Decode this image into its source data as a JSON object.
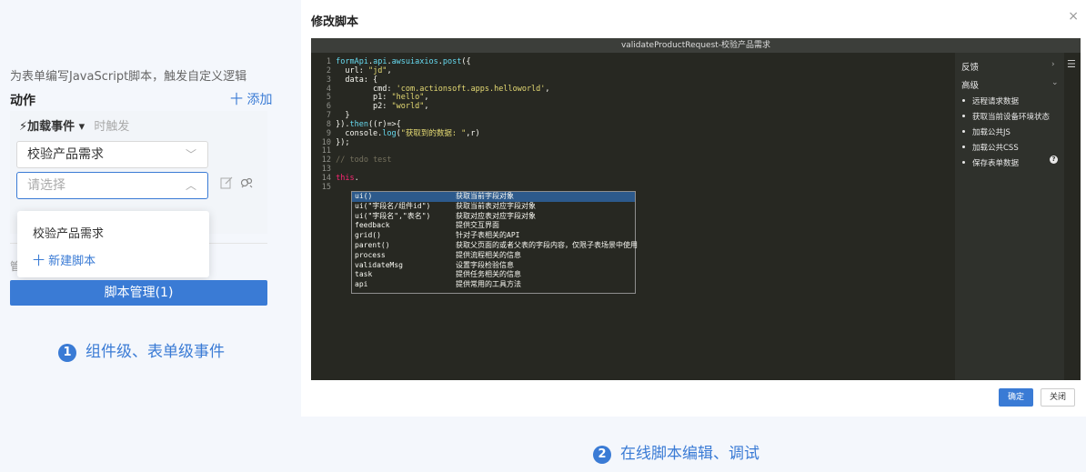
{
  "left": {
    "description": "为表单编写JavaScript脚本，触发自定义逻辑",
    "actions_title": "动作",
    "add_label": "十 添加",
    "event_label": "⚡加载事件 ▾",
    "trigger_label": "时触发",
    "select1_value": "校验产品需求",
    "select2_placeholder": "请选择",
    "dropdown": [
      "校验产品需求",
      "十 新建脚本"
    ],
    "hidden_label": "管",
    "manage_button": "脚本管理(1)",
    "caption_num": "1",
    "caption_text": "组件级、表单级事件"
  },
  "dialog": {
    "title": "修改脚本",
    "editor_title": "validateProductRequest-校验产品需求",
    "line_numbers": [
      "1",
      "2",
      "3",
      "4",
      "5",
      "6",
      "7",
      "8",
      "9",
      "10",
      "11",
      "12",
      "13",
      "14",
      "15"
    ],
    "autocomplete": [
      {
        "name": "ui()",
        "desc": "获取当前字段对象"
      },
      {
        "name": "ui(\"字段名/组件id\")",
        "desc": "获取当前表对应字段对象"
      },
      {
        "name": "ui(\"字段名\",\"表名\")",
        "desc": "获取对应表对应字段对象"
      },
      {
        "name": "feedback",
        "desc": "提供交互界面"
      },
      {
        "name": "grid()",
        "desc": "针对子表相关的API"
      },
      {
        "name": "parent()",
        "desc": "获取父页面的或者父表的字段内容，仅限子表场景中使用"
      },
      {
        "name": "process",
        "desc": "提供流程相关的信息"
      },
      {
        "name": "validateMsg",
        "desc": "设置字段检验信息"
      },
      {
        "name": "task",
        "desc": "提供任务相关的信息"
      },
      {
        "name": "api",
        "desc": "提供常用的工具方法"
      }
    ],
    "side": {
      "feedback": "反馈",
      "advanced": "高级",
      "items": [
        "远程请求数据",
        "获取当前设备环境状态",
        "加载公共JS",
        "加载公共CSS",
        "保存表单数据"
      ]
    },
    "ok_button": "确定",
    "close_button": "关闭"
  },
  "caption2": {
    "num": "2",
    "text": "在线脚本编辑、调试"
  }
}
